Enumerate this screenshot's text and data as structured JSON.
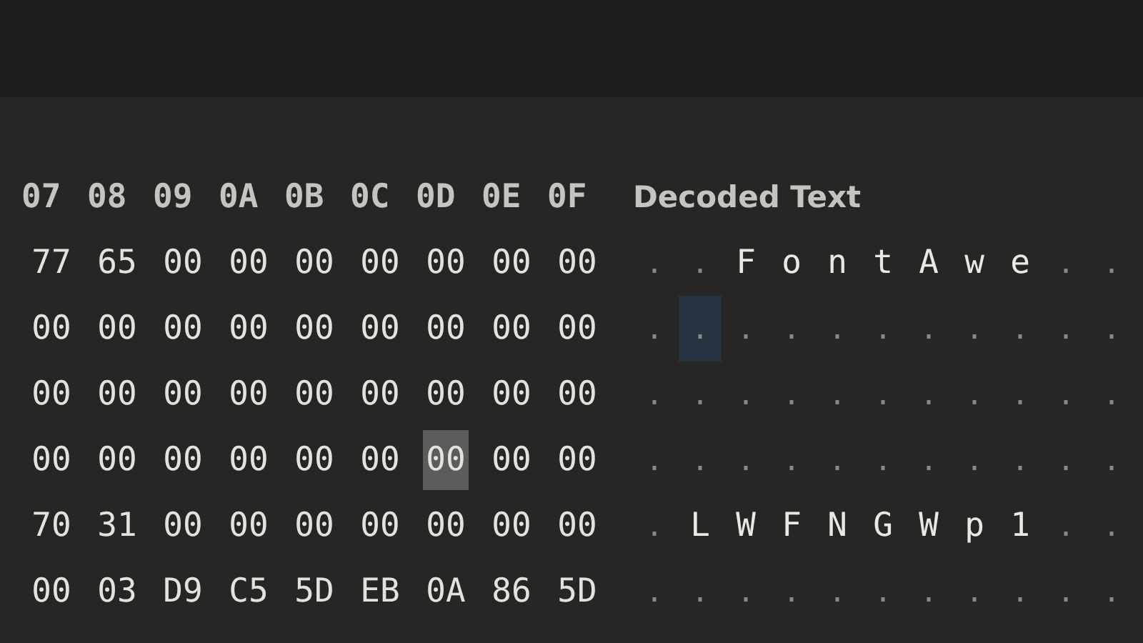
{
  "hex_columns": [
    "07",
    "08",
    "09",
    "0A",
    "0B",
    "0C",
    "0D",
    "0E",
    "0F"
  ],
  "decoded_header": "Decoded Text",
  "hex_rows": [
    [
      {
        "text": "77",
        "selected": false
      },
      {
        "text": "65",
        "selected": false
      },
      {
        "text": "00",
        "selected": false
      },
      {
        "text": "00",
        "selected": false
      },
      {
        "text": "00",
        "selected": false
      },
      {
        "text": "00",
        "selected": false
      },
      {
        "text": "00",
        "selected": false
      },
      {
        "text": "00",
        "selected": false
      },
      {
        "text": "00",
        "selected": false
      }
    ],
    [
      {
        "text": "00",
        "selected": false
      },
      {
        "text": "00",
        "selected": false
      },
      {
        "text": "00",
        "selected": false
      },
      {
        "text": "00",
        "selected": false
      },
      {
        "text": "00",
        "selected": false
      },
      {
        "text": "00",
        "selected": false
      },
      {
        "text": "00",
        "selected": false
      },
      {
        "text": "00",
        "selected": false
      },
      {
        "text": "00",
        "selected": false
      }
    ],
    [
      {
        "text": "00",
        "selected": false
      },
      {
        "text": "00",
        "selected": false
      },
      {
        "text": "00",
        "selected": false
      },
      {
        "text": "00",
        "selected": false
      },
      {
        "text": "00",
        "selected": false
      },
      {
        "text": "00",
        "selected": false
      },
      {
        "text": "00",
        "selected": false
      },
      {
        "text": "00",
        "selected": false
      },
      {
        "text": "00",
        "selected": false
      }
    ],
    [
      {
        "text": "00",
        "selected": false
      },
      {
        "text": "00",
        "selected": false
      },
      {
        "text": "00",
        "selected": false
      },
      {
        "text": "00",
        "selected": false
      },
      {
        "text": "00",
        "selected": false
      },
      {
        "text": "00",
        "selected": false
      },
      {
        "text": "00",
        "selected": true
      },
      {
        "text": "00",
        "selected": false
      },
      {
        "text": "00",
        "selected": false
      }
    ],
    [
      {
        "text": "70",
        "selected": false
      },
      {
        "text": "31",
        "selected": false
      },
      {
        "text": "00",
        "selected": false
      },
      {
        "text": "00",
        "selected": false
      },
      {
        "text": "00",
        "selected": false
      },
      {
        "text": "00",
        "selected": false
      },
      {
        "text": "00",
        "selected": false
      },
      {
        "text": "00",
        "selected": false
      },
      {
        "text": "00",
        "selected": false
      }
    ],
    [
      {
        "text": "00",
        "selected": false
      },
      {
        "text": "03",
        "selected": false
      },
      {
        "text": "D9",
        "selected": false
      },
      {
        "text": "C5",
        "selected": false
      },
      {
        "text": "5D",
        "selected": false
      },
      {
        "text": "EB",
        "selected": false
      },
      {
        "text": "0A",
        "selected": false
      },
      {
        "text": "86",
        "selected": false
      },
      {
        "text": "5D",
        "selected": false
      }
    ]
  ],
  "decoded_rows": [
    [
      {
        "kind": "dot",
        "text": ".",
        "highlighted": false
      },
      {
        "kind": "dot",
        "text": ".",
        "highlighted": false
      },
      {
        "kind": "char",
        "text": "F",
        "highlighted": false
      },
      {
        "kind": "char",
        "text": "o",
        "highlighted": false
      },
      {
        "kind": "char",
        "text": "n",
        "highlighted": false
      },
      {
        "kind": "char",
        "text": "t",
        "highlighted": false
      },
      {
        "kind": "char",
        "text": "A",
        "highlighted": false
      },
      {
        "kind": "char",
        "text": "w",
        "highlighted": false
      },
      {
        "kind": "char",
        "text": "e",
        "highlighted": false
      },
      {
        "kind": "dot",
        "text": ".",
        "highlighted": false
      },
      {
        "kind": "dot",
        "text": ".",
        "highlighted": false
      }
    ],
    [
      {
        "kind": "dot",
        "text": ".",
        "highlighted": false
      },
      {
        "kind": "dot",
        "text": ".",
        "highlighted": true
      },
      {
        "kind": "dot",
        "text": ".",
        "highlighted": false
      },
      {
        "kind": "dot",
        "text": ".",
        "highlighted": false
      },
      {
        "kind": "dot",
        "text": ".",
        "highlighted": false
      },
      {
        "kind": "dot",
        "text": ".",
        "highlighted": false
      },
      {
        "kind": "dot",
        "text": ".",
        "highlighted": false
      },
      {
        "kind": "dot",
        "text": ".",
        "highlighted": false
      },
      {
        "kind": "dot",
        "text": ".",
        "highlighted": false
      },
      {
        "kind": "dot",
        "text": ".",
        "highlighted": false
      },
      {
        "kind": "dot",
        "text": ".",
        "highlighted": false
      }
    ],
    [
      {
        "kind": "dot",
        "text": ".",
        "highlighted": false
      },
      {
        "kind": "dot",
        "text": ".",
        "highlighted": false
      },
      {
        "kind": "dot",
        "text": ".",
        "highlighted": false
      },
      {
        "kind": "dot",
        "text": ".",
        "highlighted": false
      },
      {
        "kind": "dot",
        "text": ".",
        "highlighted": false
      },
      {
        "kind": "dot",
        "text": ".",
        "highlighted": false
      },
      {
        "kind": "dot",
        "text": ".",
        "highlighted": false
      },
      {
        "kind": "dot",
        "text": ".",
        "highlighted": false
      },
      {
        "kind": "dot",
        "text": ".",
        "highlighted": false
      },
      {
        "kind": "dot",
        "text": ".",
        "highlighted": false
      },
      {
        "kind": "dot",
        "text": ".",
        "highlighted": false
      }
    ],
    [
      {
        "kind": "dot",
        "text": ".",
        "highlighted": false
      },
      {
        "kind": "dot",
        "text": ".",
        "highlighted": false
      },
      {
        "kind": "dot",
        "text": ".",
        "highlighted": false
      },
      {
        "kind": "dot",
        "text": ".",
        "highlighted": false
      },
      {
        "kind": "dot",
        "text": ".",
        "highlighted": false
      },
      {
        "kind": "dot",
        "text": ".",
        "highlighted": false
      },
      {
        "kind": "dot",
        "text": ".",
        "highlighted": false
      },
      {
        "kind": "dot",
        "text": ".",
        "highlighted": false
      },
      {
        "kind": "dot",
        "text": ".",
        "highlighted": false
      },
      {
        "kind": "dot",
        "text": ".",
        "highlighted": false
      },
      {
        "kind": "dot",
        "text": ".",
        "highlighted": false
      }
    ],
    [
      {
        "kind": "dot",
        "text": ".",
        "highlighted": false
      },
      {
        "kind": "char",
        "text": "L",
        "highlighted": false
      },
      {
        "kind": "char",
        "text": "W",
        "highlighted": false
      },
      {
        "kind": "char",
        "text": "F",
        "highlighted": false
      },
      {
        "kind": "char",
        "text": "N",
        "highlighted": false
      },
      {
        "kind": "char",
        "text": "G",
        "highlighted": false
      },
      {
        "kind": "char",
        "text": "W",
        "highlighted": false
      },
      {
        "kind": "char",
        "text": "p",
        "highlighted": false
      },
      {
        "kind": "char",
        "text": "1",
        "highlighted": false
      },
      {
        "kind": "dot",
        "text": ".",
        "highlighted": false
      },
      {
        "kind": "dot",
        "text": ".",
        "highlighted": false
      }
    ],
    [
      {
        "kind": "dot",
        "text": ".",
        "highlighted": false
      },
      {
        "kind": "dot",
        "text": ".",
        "highlighted": false
      },
      {
        "kind": "dot",
        "text": ".",
        "highlighted": false
      },
      {
        "kind": "dot",
        "text": ".",
        "highlighted": false
      },
      {
        "kind": "dot",
        "text": ".",
        "highlighted": false
      },
      {
        "kind": "dot",
        "text": ".",
        "highlighted": false
      },
      {
        "kind": "dot",
        "text": ".",
        "highlighted": false
      },
      {
        "kind": "dot",
        "text": ".",
        "highlighted": false
      },
      {
        "kind": "dot",
        "text": ".",
        "highlighted": false
      },
      {
        "kind": "dot",
        "text": ".",
        "highlighted": false
      },
      {
        "kind": "dot",
        "text": ".",
        "highlighted": false
      }
    ]
  ]
}
